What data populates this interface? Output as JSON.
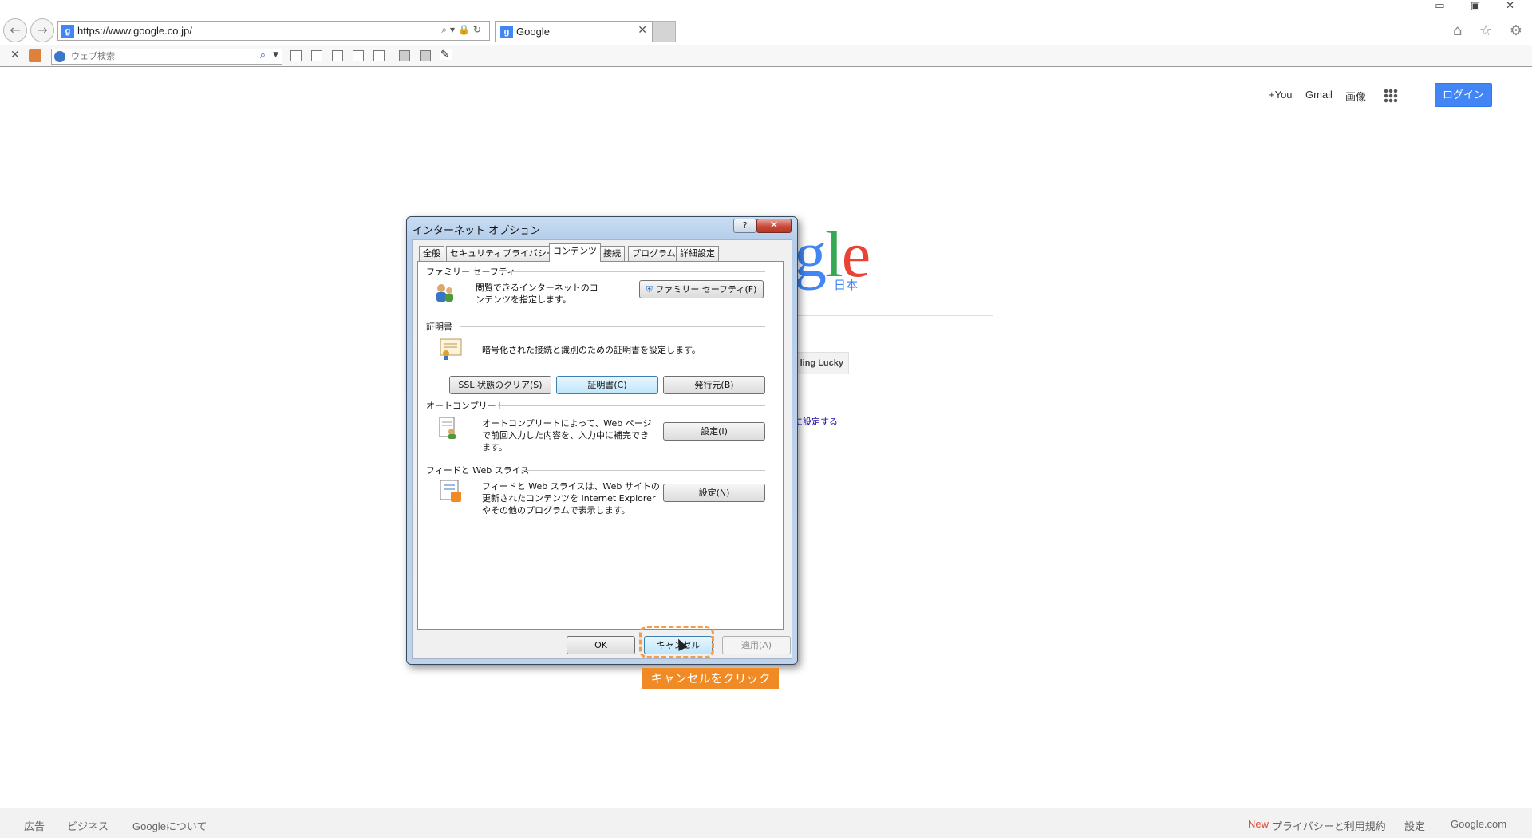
{
  "browser": {
    "url": "https://www.google.co.jp/",
    "tab_title": "Google",
    "tab_favicon": "g",
    "search_placeholder": "ウェブ検索",
    "win_controls": "▭ ▣ ✕",
    "right_icons": "⌂ ☆ ⚙"
  },
  "google": {
    "top_links": [
      "+You",
      "Gmail",
      "画像"
    ],
    "login": "ログイン",
    "logo_g": "g",
    "logo_l": "l",
    "logo_e": "e",
    "logo_sub": "日本",
    "lucky": "ling Lucky",
    "set_link": "に設定する",
    "footer_left": [
      "広告",
      "ビジネス",
      "Googleについて"
    ],
    "footer_new": "New",
    "footer_right": [
      "プライバシーと利用規約",
      "設定",
      "Google.com"
    ]
  },
  "dialog": {
    "title": "インターネット オプション",
    "help": "?",
    "close": "✕",
    "tabs": [
      "全般",
      "セキュリティ",
      "プライバシー",
      "コンテンツ",
      "接続",
      "プログラム",
      "詳細設定"
    ],
    "family": {
      "heading": "ファミリー セーフティ",
      "desc": "閲覧できるインターネットのコンテンツを指定します。",
      "button": "ファミリー セーフティ(F)"
    },
    "cert": {
      "heading": "証明書",
      "desc": "暗号化された接続と識別のための証明書を設定します。",
      "btn_clear": "SSL 状態のクリア(S)",
      "btn_cert": "証明書(C)",
      "btn_publisher": "発行元(B)"
    },
    "autocomplete": {
      "heading": "オートコンプリート",
      "desc": "オートコンプリートによって、Web ページで前回入力した内容を、入力中に補完できます。",
      "button": "設定(I)"
    },
    "feeds": {
      "heading": "フィードと Web スライス",
      "desc": "フィードと Web スライスは、Web サイトの更新されたコンテンツを Internet Explorer やその他のプログラムで表示します。",
      "button": "設定(N)"
    },
    "ok": "OK",
    "cancel": "キャンセル",
    "apply": "適用(A)"
  },
  "annotation": {
    "tooltip": "キャンセルをクリック",
    "color": "#f08a24"
  }
}
